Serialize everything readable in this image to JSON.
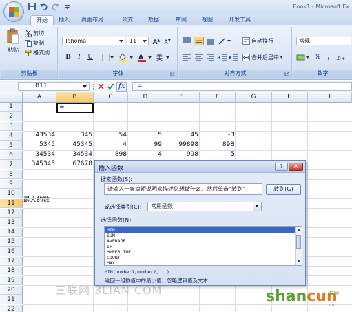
{
  "app": {
    "title": "Book1 - Microsoft Ex"
  },
  "ribbon": {
    "tabs": [
      "开始",
      "插入",
      "页面布局",
      "公式",
      "数据",
      "审阅",
      "视图",
      "开发工具"
    ],
    "active_tab": "开始",
    "clipboard": {
      "paste": "粘贴",
      "cut": "剪切",
      "copy": "复制",
      "format_painter": "格式刷",
      "group_label": "剪贴板"
    },
    "font": {
      "family": "Tahoma",
      "size": "11",
      "bold": "B",
      "italic": "I",
      "underline": "U",
      "group_label": "字体"
    },
    "alignment": {
      "wrap_text": "自动换行",
      "merge_center": "合并后居中",
      "group_label": "对齐方式"
    },
    "number": {
      "format": "常规",
      "percent": "%",
      "comma": ",",
      "group_label": "数字"
    }
  },
  "formula_bar": {
    "name_box": "B11",
    "fx": "fx",
    "formula": "="
  },
  "grid": {
    "columns": [
      "A",
      "B",
      "C",
      "D",
      "E",
      "F",
      "G",
      "H",
      "I"
    ],
    "selected_column": "B",
    "rows": [
      "1",
      "2",
      "3",
      "4",
      "5",
      "6",
      "7",
      "8",
      "9",
      "10",
      "11",
      "12",
      "13",
      "14",
      "15",
      "16",
      "17",
      "18",
      "19",
      "20",
      "21",
      "22"
    ],
    "selected_row": "11",
    "data": [
      [
        "43534",
        "345",
        "54",
        "5",
        "45",
        "-3"
      ],
      [
        "5345",
        "45345",
        "4",
        "99",
        "99898",
        "898"
      ],
      [
        "34534",
        "34534",
        "898",
        "4",
        "998",
        "5"
      ],
      [
        "345345",
        "67678",
        "",
        "",
        "",
        ""
      ]
    ],
    "label_a11": "最大的数",
    "active_cell_value": "="
  },
  "dialog": {
    "title": "插入函数",
    "help": "?",
    "close": "×",
    "search_label": "搜索函数(S):",
    "search_value": "请输入一条简短说明来描述您想做什么，然后单击“转到”",
    "go_button": "转到(G)",
    "category_label": "或选择类别(C):",
    "category_value": "常用函数",
    "list_label": "选择函数(N):",
    "functions": [
      "MIN",
      "SUM",
      "AVERAGE",
      "IF",
      "HYPERLINK",
      "COUNT",
      "MAX"
    ],
    "selected_function": "MIN",
    "syntax": "MIN(number1,number2,...)",
    "description": "返回一组数值中的最小值，忽略逻辑值及文本"
  },
  "watermarks": {
    "site_cn": "三联网 3LIAN.COM",
    "brand_left": "shan",
    "brand_right": "cun",
    "brand_suffix": ".net",
    "brand_cn": "山村网"
  }
}
